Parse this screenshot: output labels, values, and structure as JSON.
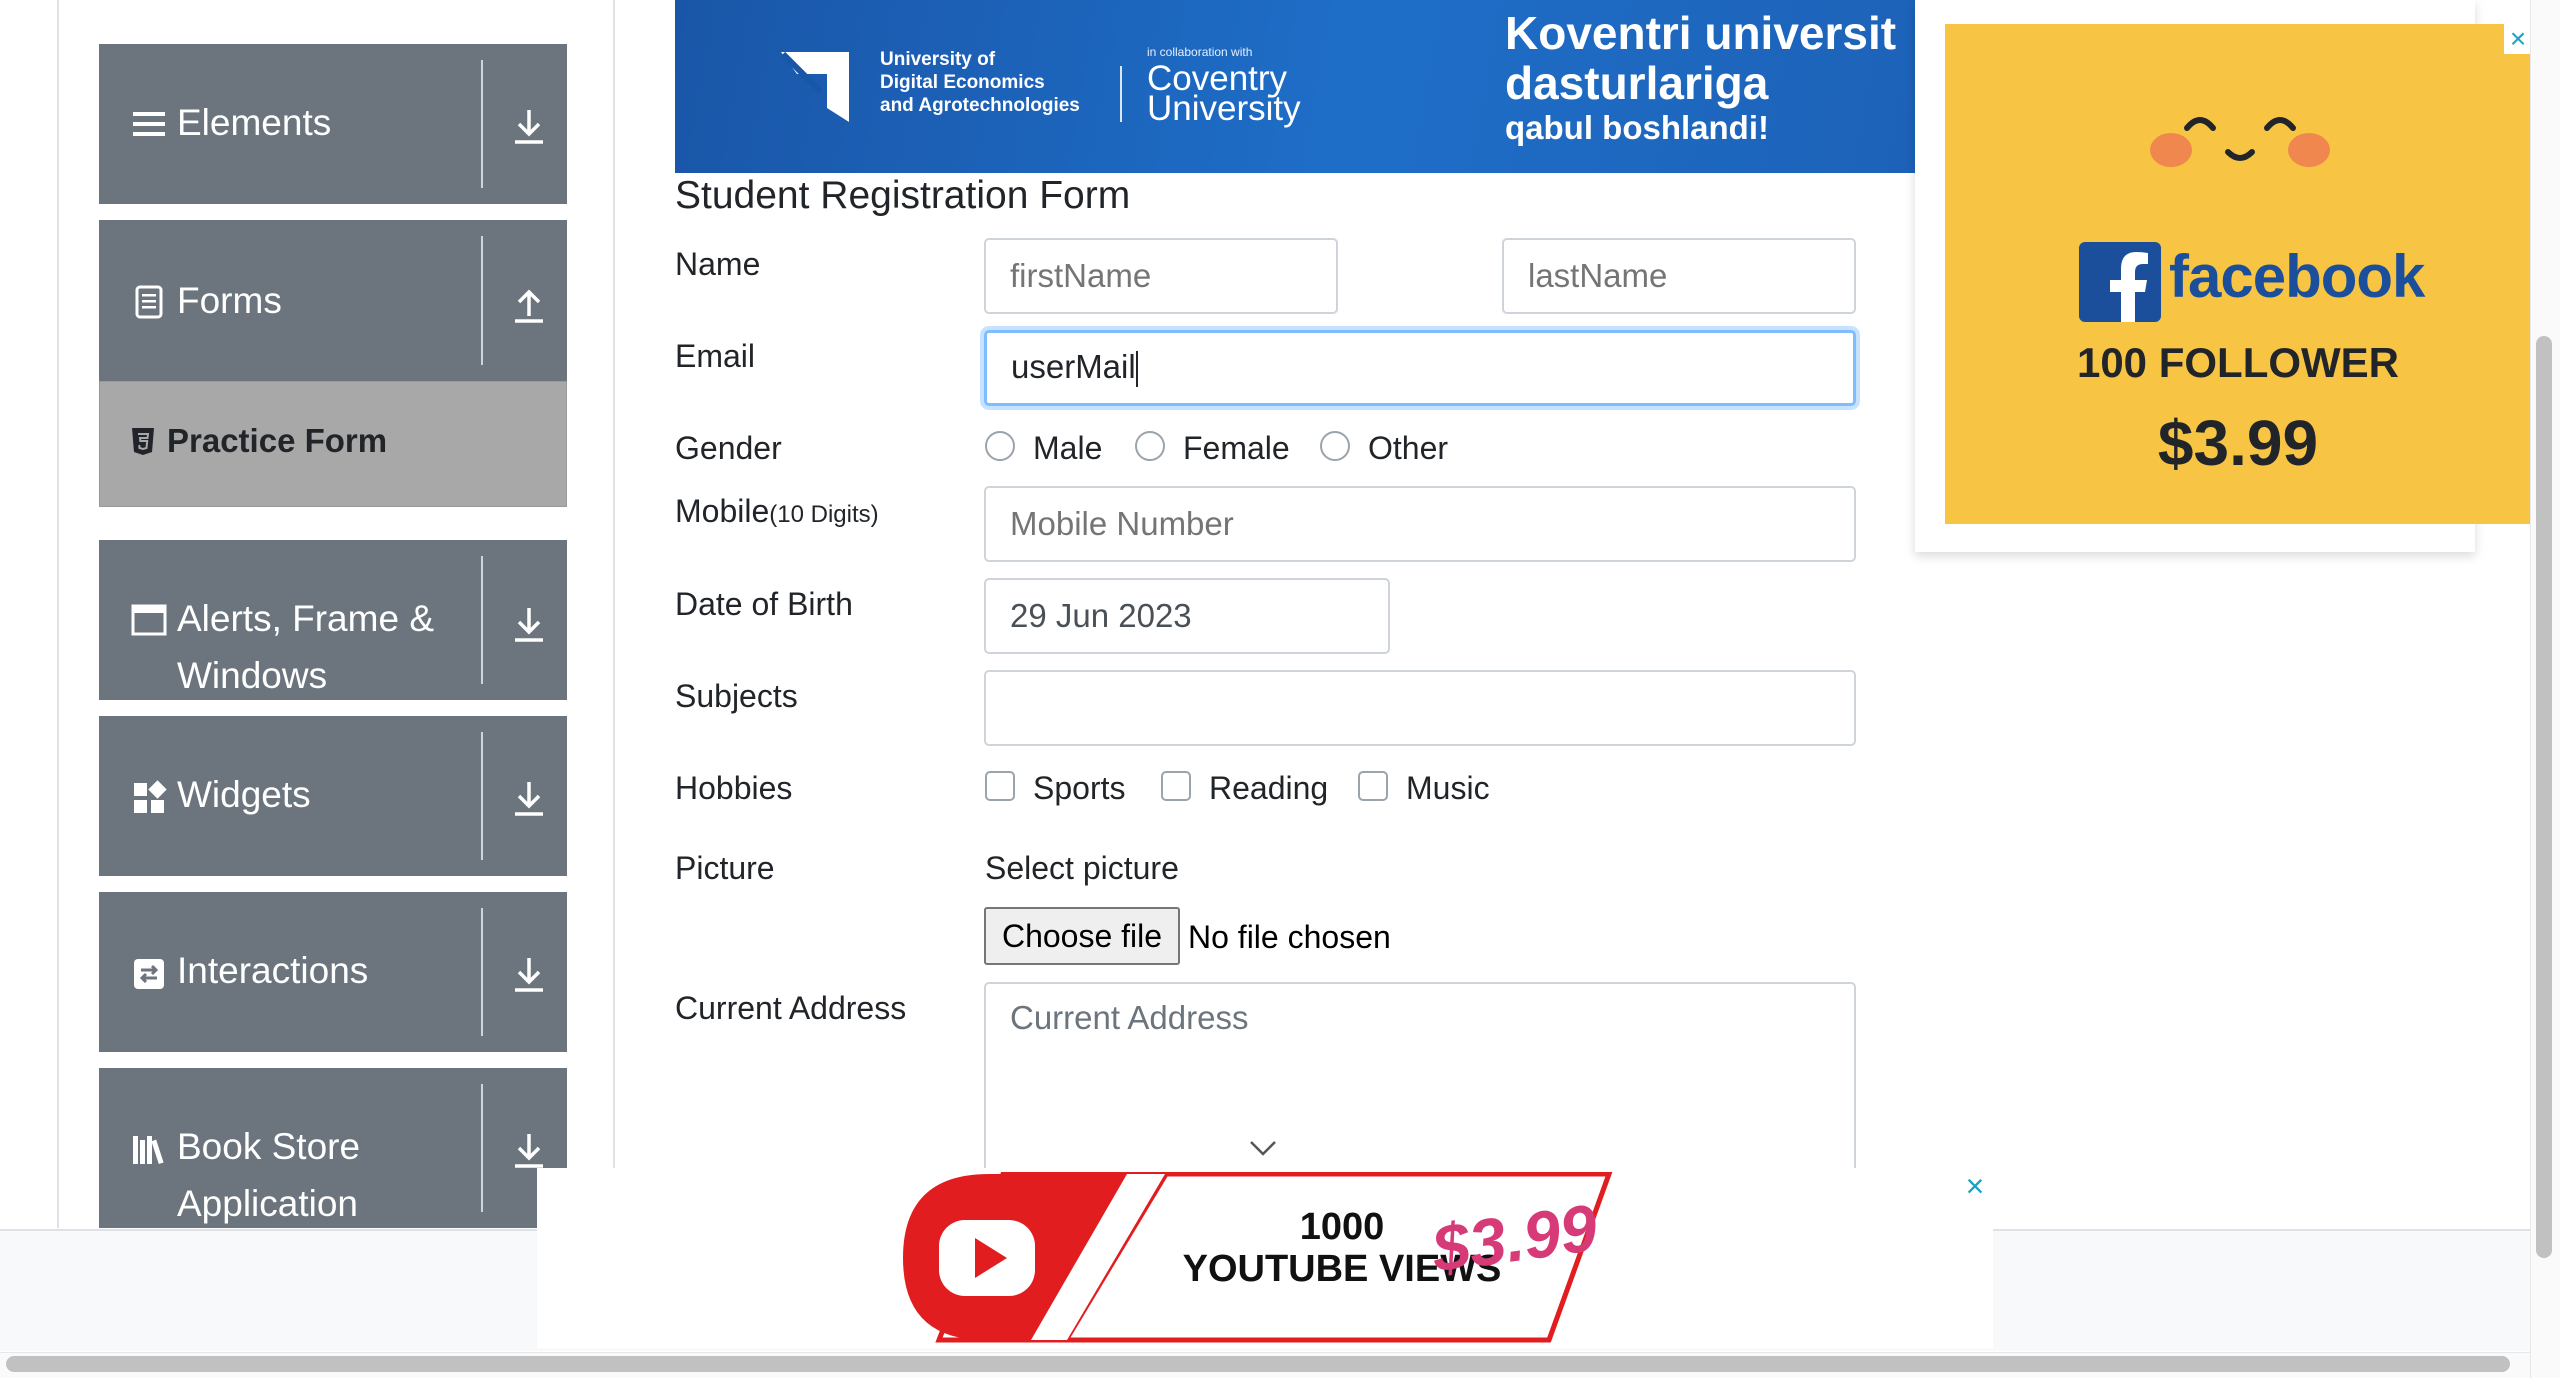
{
  "sidebar": {
    "groups": [
      {
        "label": "Elements",
        "icon": "hamburger-icon",
        "arrow": "download-arrow-icon"
      },
      {
        "label": "Forms",
        "icon": "form-list-icon",
        "arrow": "upload-arrow-icon"
      },
      {
        "label_line1": "Alerts, Frame &",
        "label_line2": "Windows",
        "icon": "window-icon",
        "arrow": "download-arrow-icon"
      },
      {
        "label": "Widgets",
        "icon": "widgets-icon",
        "arrow": "download-arrow-icon"
      },
      {
        "label": "Interactions",
        "icon": "interactions-icon",
        "arrow": "download-arrow-icon"
      },
      {
        "label_line1": "Book Store",
        "label_line2": "Application",
        "icon": "books-icon",
        "arrow": "download-arrow-icon"
      }
    ],
    "active_item": "Practice Form"
  },
  "banner": {
    "univ_line1": "University of",
    "univ_line2": "Digital Economics",
    "univ_line3": "and Agrotechnologies",
    "collab": "in collaboration with",
    "partner_line1": "Coventry",
    "partner_line2": "University",
    "promo_line1": "Koventri universit",
    "promo_line2": "dasturlariga",
    "promo_line3": "qabul boshlandi!"
  },
  "form": {
    "title": "Student Registration Form",
    "name_label": "Name",
    "first_name_placeholder": "firstName",
    "last_name_placeholder": "lastName",
    "email_label": "Email",
    "email_value": "userMail",
    "gender_label": "Gender",
    "gender_options": [
      "Male",
      "Female",
      "Other"
    ],
    "mobile_label": "Mobile",
    "mobile_hint": "(10 Digits)",
    "mobile_placeholder": "Mobile Number",
    "dob_label": "Date of Birth",
    "dob_value": "29 Jun 2023",
    "subjects_label": "Subjects",
    "hobbies_label": "Hobbies",
    "hobby_options": [
      "Sports",
      "Reading",
      "Music"
    ],
    "picture_label": "Picture",
    "picture_caption": "Select picture",
    "choose_file_label": "Choose file",
    "no_file_text": "No file chosen",
    "address_label": "Current Address",
    "address_placeholder": "Current Address"
  },
  "ad_right": {
    "brand": "facebook",
    "offer": "100 FOLLOWER",
    "price": "$3.99",
    "close": "×"
  },
  "ad_bottom": {
    "line1": "1000",
    "line2": "YOUTUBE VIEWS",
    "price": "$3.99",
    "close": "×"
  },
  "colors": {
    "sidebar_group": "#6c757d",
    "active_item": "#a8a8a8",
    "banner": "#1e6ec8",
    "focus_ring": "#80bdff",
    "ad_yellow": "#f7c443",
    "fb_blue": "#1b4f9c",
    "yt_red": "#e11d20",
    "close_cyan": "#16a2c9"
  }
}
